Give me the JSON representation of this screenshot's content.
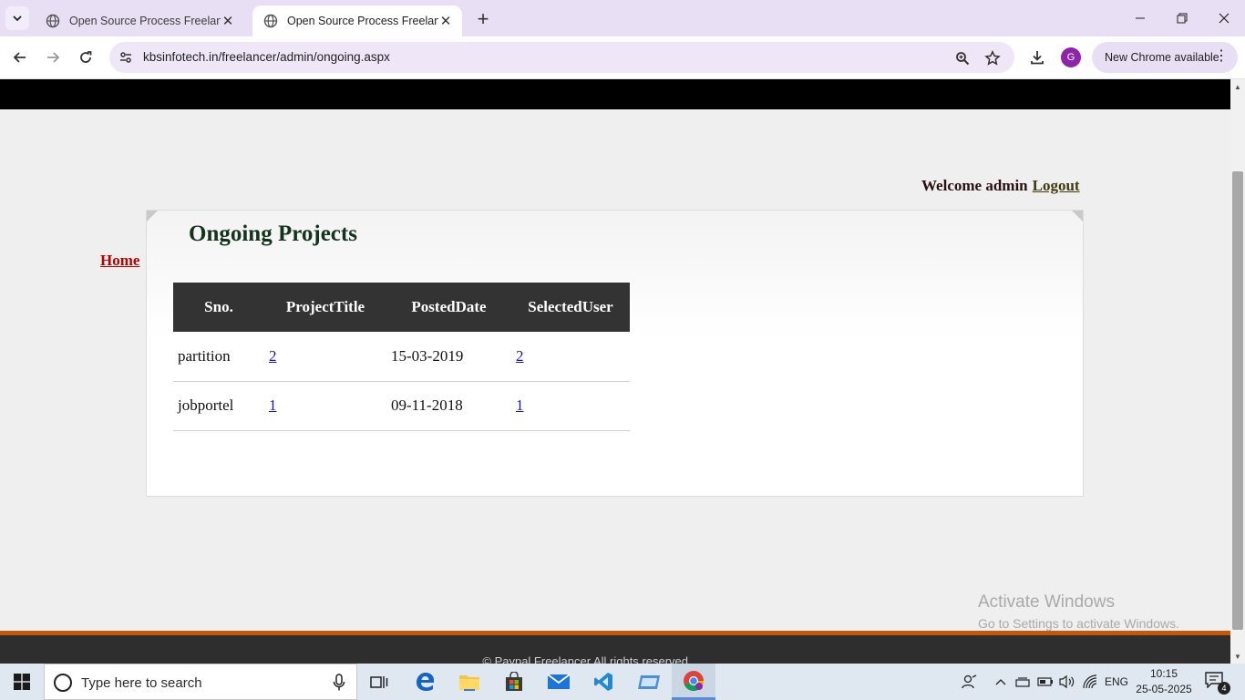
{
  "browser": {
    "tabs": [
      {
        "title": "Open Source Process Freelancer",
        "active": false
      },
      {
        "title": "Open Source Process Freelancer",
        "active": true
      }
    ],
    "url": "kbsinfotech.in/freelancer/admin/ongoing.aspx",
    "update_chip": "New Chrome available",
    "profile_initial": "G"
  },
  "page": {
    "welcome_text": "Welcome admin",
    "logout_label": "Logout",
    "home_label": "Home",
    "panel_title": "Ongoing Projects",
    "table": {
      "headers": [
        "Sno.",
        "ProjectTitle",
        "PostedDate",
        "SelectedUser"
      ],
      "rows": [
        {
          "sno": "partition",
          "project_title": "2",
          "posted_date": "15-03-2019",
          "selected_user": "2"
        },
        {
          "sno": "jobportel",
          "project_title": "1",
          "posted_date": "09-11-2018",
          "selected_user": "1"
        }
      ]
    },
    "copyright": "© Paypal Freelancer.All rights reserved."
  },
  "watermark": {
    "line1": "Activate Windows",
    "line2": "Go to Settings to activate Windows."
  },
  "taskbar": {
    "search_placeholder": "Type here to search",
    "language": "ENG",
    "time": "10:15",
    "date": "25-05-2025",
    "notification_count": "4"
  },
  "colors": {
    "tabstrip": "#e9dff5",
    "footer_accent": "#c8560a",
    "table_header": "#333333",
    "home_link": "#b80000"
  }
}
